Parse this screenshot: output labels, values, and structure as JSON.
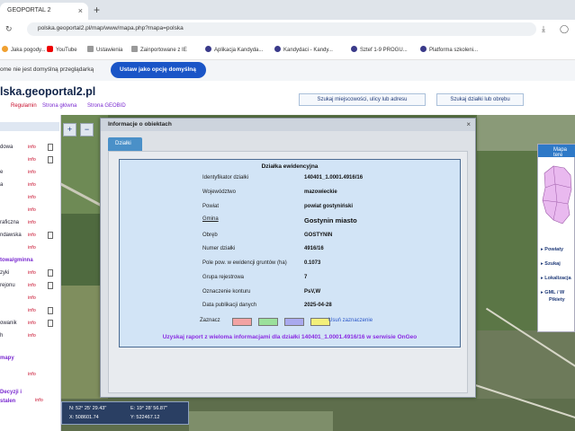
{
  "browser": {
    "tab_title": "GEOPORTAL 2",
    "new_tab": "+",
    "url": "polska.geoportal2.pl/map/www/mapa.php?mapa=polska",
    "bookmarks": [
      "Jaka pogody...",
      "YouTube",
      "Ustawienia",
      "Zainportowane z IE",
      "Aplikacja Kandyda...",
      "Kandydaci - Kandy...",
      "Sztef 1-9 PROGU...",
      "Platforma szkoleni..."
    ]
  },
  "notice": {
    "text": "ome nie jest domyślną przeglądarką",
    "button": "Ustaw jako opcję domyślną"
  },
  "site": {
    "logo": "lska.geoportal2.pl",
    "nav": [
      "",
      "Regulamin",
      "Strona główna",
      "Strona GEOBID"
    ],
    "search_address": "Szukaj miejscowości, ulicy lub adresu",
    "search_parcel": "Szukaj działki lub obrębu"
  },
  "left_panel": {
    "rows": [
      {
        "label": "dowa",
        "info": "info"
      },
      {
        "label": "",
        "info": "info"
      },
      {
        "label": "e",
        "info": "info"
      },
      {
        "label": "a",
        "info": "info"
      },
      {
        "label": "",
        "info": "info"
      },
      {
        "label": "",
        "info": "info"
      },
      {
        "label": "raficzna",
        "info": "info"
      },
      {
        "label": "ndawska",
        "info": "info"
      },
      {
        "label": "",
        "info": "info"
      },
      {
        "label": "towa/gminna",
        "info": ""
      },
      {
        "label": "zyki",
        "info": "info"
      },
      {
        "label": "rejonu",
        "info": "info"
      },
      {
        "label": "",
        "info": "info"
      },
      {
        "label": "",
        "info": "info"
      },
      {
        "label": "owanik",
        "info": "info"
      },
      {
        "label": "h",
        "info": "info"
      },
      {
        "label": "mapy",
        "info": ""
      },
      {
        "label": "",
        "info": "info"
      },
      {
        "label": "Decyzji i",
        "info": "info"
      },
      {
        "label": "stalen",
        "info": ""
      }
    ]
  },
  "zoom": {
    "in": "+",
    "out": "−"
  },
  "dialog": {
    "title": "Informacje o obiektach",
    "close": "×",
    "tab": "Działki",
    "panel_title": "Działka ewidencyjna",
    "rows": [
      {
        "k": "Identyfikator działki",
        "v": "140401_1.0001.4916/16"
      },
      {
        "k": "Województwo",
        "v": "mazowieckie"
      },
      {
        "k": "Powiat",
        "v": "powiat gostyniński"
      },
      {
        "k": "Gmina",
        "v": "Gostynin miasto"
      },
      {
        "k": "Obręb",
        "v": "GOSTYNIN"
      },
      {
        "k": "Numer działki",
        "v": "4916/16"
      },
      {
        "k": "Pole pow. w ewidencji gruntów (ha)",
        "v": "0.1073"
      },
      {
        "k": "Grupa rejestrowa",
        "v": "7"
      },
      {
        "k": "Oznaczenie konturu",
        "v": "PsV,W"
      },
      {
        "k": "Data publikacji danych",
        "v": "2025-04-28"
      }
    ],
    "zaznacz": "Zaznacz",
    "swatch_colors": [
      "#f2a3a3",
      "#9be09b",
      "#a9a9ee",
      "#f3f07a"
    ],
    "odznacz": "Usuń zaznaczenie",
    "raport": "Uzyskaj raport z wieloma informacjami dla działki 140401_1.0001.4916/16 w serwisie OnGeo"
  },
  "right_panel": {
    "header": "Mapa tere",
    "items": [
      "Powiaty",
      "Szukaj",
      "Lokalizacja",
      "GML / W",
      "Pikiety"
    ]
  },
  "coords": {
    "lat": "N: 52° 25' 29.43\"",
    "lon": "E: 19° 28' 56.87\"",
    "x": "X: 508601.74",
    "y": "Y: 522467.12"
  }
}
